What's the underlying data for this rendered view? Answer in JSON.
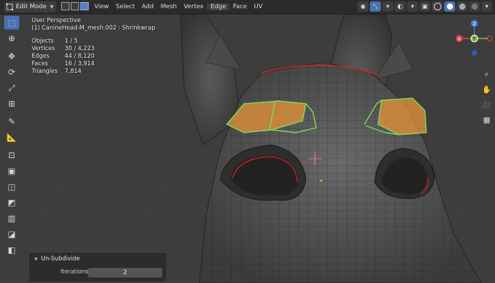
{
  "header": {
    "mode": "Edit Mode",
    "menu": [
      "View",
      "Select",
      "Add",
      "Mesh",
      "Vertex",
      "Edge",
      "Face",
      "UV"
    ],
    "highlighted_menu": "Edge",
    "select_modes": [
      "vertex-select-icon",
      "edge-select-icon",
      "face-select-icon"
    ],
    "active_select_mode": "face-select-icon"
  },
  "overlay": {
    "perspective": "User Perspective",
    "object": "(1) CanineHead-M_mesh.002 : Shrinkwrap",
    "stats": [
      {
        "label": "Objects",
        "value": "1 / 5"
      },
      {
        "label": "Vertices",
        "value": "30 / 4,223"
      },
      {
        "label": "Edges",
        "value": "44 / 8,120"
      },
      {
        "label": "Faces",
        "value": "16 / 3,914"
      },
      {
        "label": "Triangles",
        "value": "7,814"
      }
    ]
  },
  "toolbar": [
    "select-box-icon",
    "cursor-icon",
    "move-icon",
    "rotate-icon",
    "scale-icon",
    "transform-icon",
    "annotate-icon",
    "measure-icon",
    "add-cube-icon",
    "extrude-icon",
    "inset-icon",
    "bevel-icon",
    "loop-cut-icon",
    "knife-icon",
    "poly-build-icon"
  ],
  "gizmo": {
    "axes": [
      "Z",
      "Y",
      "X"
    ],
    "colors": {
      "x": "#e0414f",
      "y": "#83c33a",
      "z": "#3a81d8"
    }
  },
  "nav": [
    "zoom-icon",
    "pan-icon",
    "camera-icon",
    "grid-view-icon"
  ],
  "operator_panel": {
    "title": "Un-Subdivide",
    "field_label": "Iterations",
    "field_value": "2"
  },
  "colors": {
    "selection_face": "#e8943a",
    "selection_edge": "#7de05b",
    "seam": "#e02020",
    "accent": "#4772b3"
  }
}
